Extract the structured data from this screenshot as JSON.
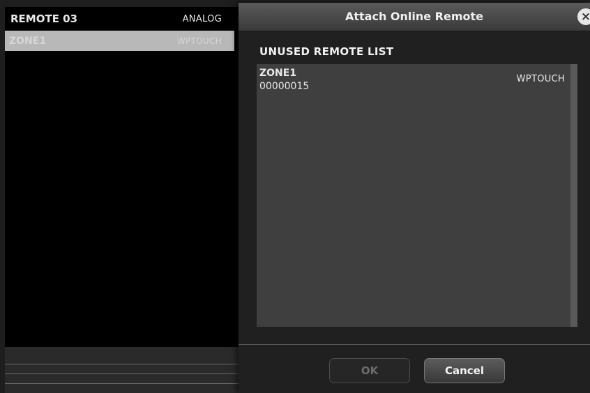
{
  "background_panel": {
    "header": {
      "name": "REMOTE 03",
      "type": "ANALOG"
    },
    "rows": [
      {
        "name": "ZONE1",
        "type": "WPTOUCH"
      }
    ]
  },
  "dialog": {
    "title": "Attach Online Remote",
    "close_icon": "close-icon",
    "list_label": "UNUSED REMOTE LIST",
    "items": [
      {
        "name": "ZONE1",
        "id": "00000015",
        "type": "WPTOUCH"
      }
    ],
    "buttons": {
      "ok": "OK",
      "cancel": "Cancel"
    }
  }
}
